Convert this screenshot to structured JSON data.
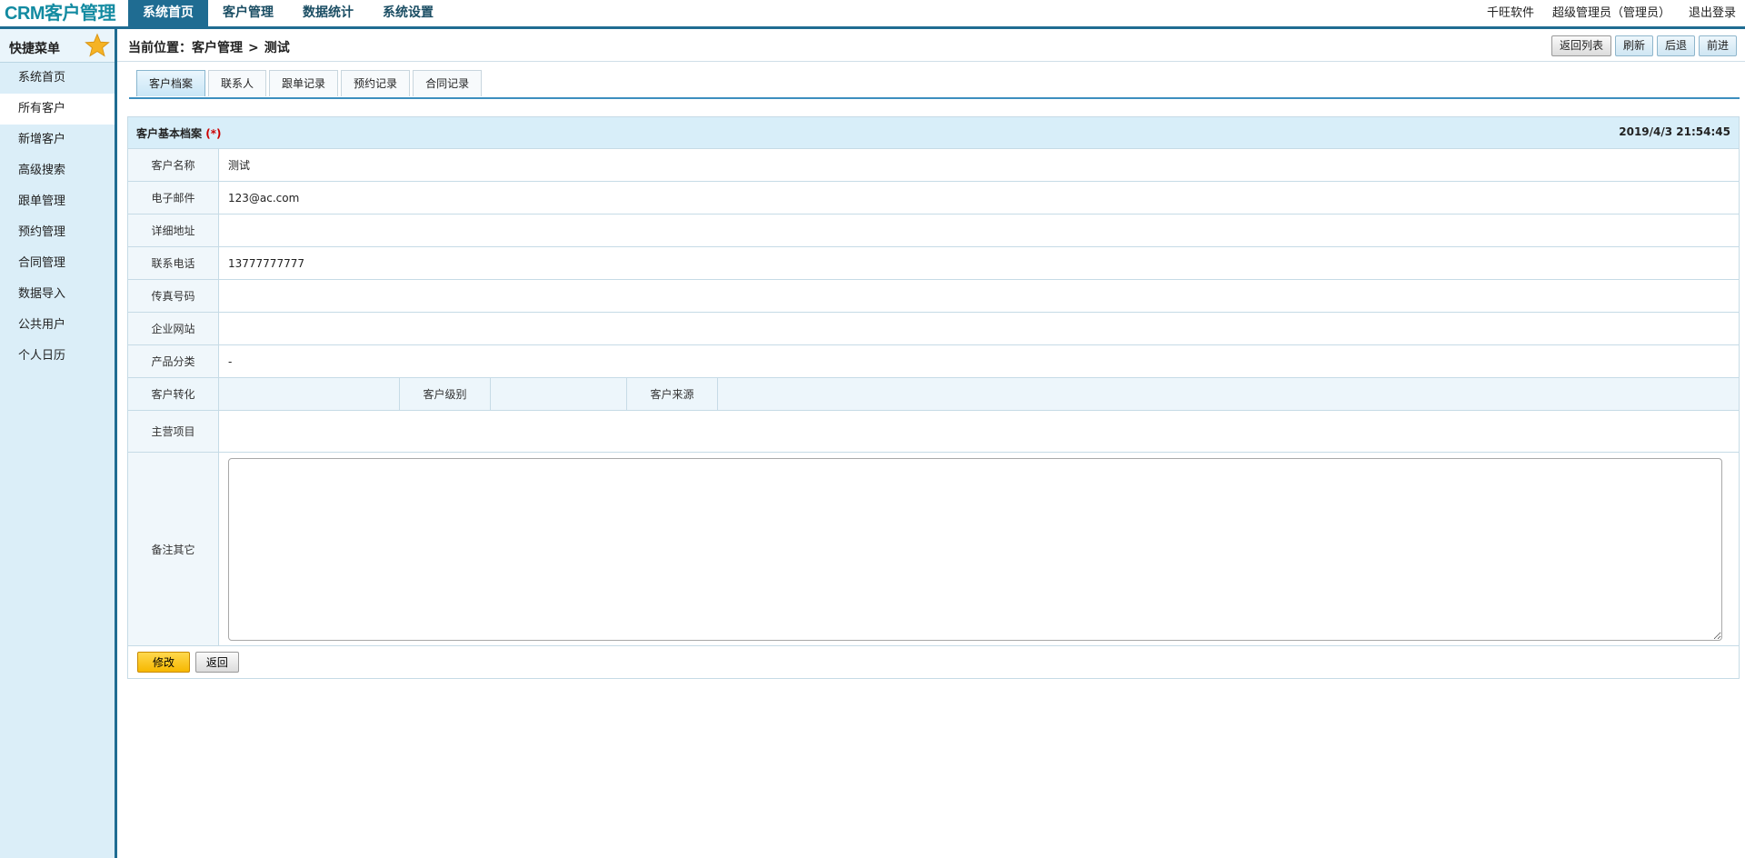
{
  "header": {
    "logo": "CRM客户管理",
    "nav": [
      "系统首页",
      "客户管理",
      "数据统计",
      "系统设置"
    ],
    "right": [
      "千旺软件",
      "超级管理员（管理员）",
      "退出登录"
    ]
  },
  "sidebar": {
    "title": "快捷菜单",
    "items": [
      "系统首页",
      "所有客户",
      "新增客户",
      "高级搜索",
      "跟单管理",
      "预约管理",
      "合同管理",
      "数据导入",
      "公共用户",
      "个人日历"
    ]
  },
  "breadcrumb": {
    "prefix": "当前位置：",
    "section": "客户管理",
    "sep": ">",
    "page": "测试"
  },
  "toolbar": {
    "back_list": "返回列表",
    "refresh": "刷新",
    "back": "后退",
    "forward": "前进"
  },
  "tabs": [
    "客户档案",
    "联系人",
    "跟单记录",
    "预约记录",
    "合同记录"
  ],
  "form": {
    "title": "客户基本档案",
    "required_mark": "(*)",
    "timestamp": "2019/4/3 21:54:45",
    "fields": {
      "name_label": "客户名称",
      "name_value": "测试",
      "email_label": "电子邮件",
      "email_value": "123@ac.com",
      "address_label": "详细地址",
      "address_value": "",
      "phone_label": "联系电话",
      "phone_value": "13777777777",
      "fax_label": "传真号码",
      "fax_value": "",
      "website_label": "企业网站",
      "website_value": "",
      "category_label": "产品分类",
      "category_value": "-",
      "conversion_label": "客户转化",
      "conversion_value": "",
      "level_label": "客户级别",
      "level_value": "",
      "source_label": "客户来源",
      "source_value": "",
      "business_label": "主营项目",
      "business_value": "",
      "notes_label": "备注其它",
      "notes_value": ""
    },
    "edit_button": "修改",
    "back_button": "返回"
  },
  "colors": {
    "nav_active": "#1f6c92",
    "logo": "#138ba1",
    "sidebar_bg": "#dbeef8",
    "edit_button": "#f6b800"
  }
}
